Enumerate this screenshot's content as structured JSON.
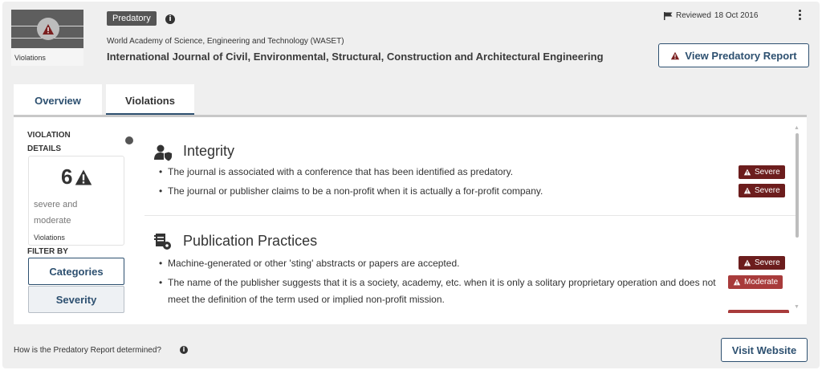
{
  "header": {
    "thumbnail_caption": "Violations",
    "status_badge": "Predatory",
    "publisher": "World Academy of Science, Engineering and Technology (WASET)",
    "journal_title": "International Journal of Civil, Environmental, Structural, Construction and Architectural Engineering",
    "reviewed_label": "Reviewed",
    "reviewed_date": "18 Oct 2016",
    "report_button": "View Predatory Report"
  },
  "tabs": [
    {
      "label": "Overview",
      "active": false
    },
    {
      "label": "Violations",
      "active": true
    }
  ],
  "sidebar": {
    "title": "VIOLATION DETAILS",
    "count": "6",
    "count_description": "severe and moderate",
    "count_caption": "Violations",
    "filter_label": "FILTER BY",
    "filters": [
      {
        "label": "Categories",
        "active": true
      },
      {
        "label": "Severity",
        "active": false
      }
    ]
  },
  "sections": [
    {
      "title": "Integrity",
      "icon": "user-shield-icon",
      "items": [
        {
          "text": "The journal is associated with a conference that has been identified as predatory.",
          "severity": "Severe"
        },
        {
          "text": "The journal or publisher claims to be a non-profit when it is actually a for-profit company.",
          "severity": "Severe"
        }
      ]
    },
    {
      "title": "Publication Practices",
      "icon": "document-gear-icon",
      "items": [
        {
          "text": "Machine-generated or other 'sting' abstracts or papers are accepted.",
          "severity": "Severe"
        },
        {
          "text": "The name of the publisher suggests that it is a society, academy, etc. when it is only a solitary proprietary operation and does not meet the definition of the term used or implied non-profit mission.",
          "severity": "Moderate"
        }
      ]
    }
  ],
  "footer": {
    "question": "How is the Predatory Report determined?",
    "visit_button": "Visit Website"
  },
  "colors": {
    "primary": "#2d5070",
    "severe": "#6c1d1d",
    "moderate": "#a83b3b",
    "badge": "#555555"
  }
}
